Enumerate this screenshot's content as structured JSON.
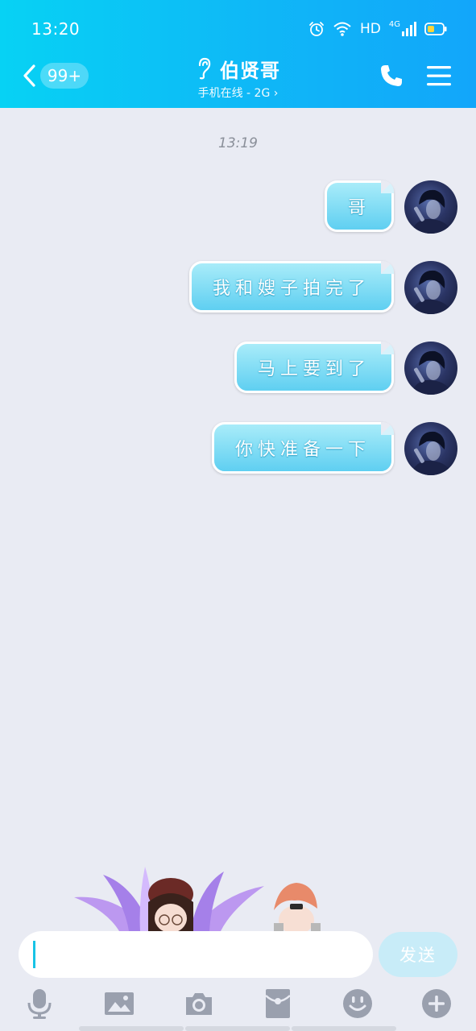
{
  "status_bar": {
    "time": "13:20",
    "network_label": "HD",
    "cellular_label": "4G"
  },
  "header": {
    "unread_count": "99+",
    "contact_name": "伯贤哥",
    "contact_status": "手机在线 - 2G ›"
  },
  "chat": {
    "timestamp": "13:19",
    "messages": [
      {
        "text": "哥",
        "direction": "outgoing"
      },
      {
        "text": "我和嫂子拍完了",
        "direction": "outgoing"
      },
      {
        "text": "马上要到了",
        "direction": "outgoing"
      },
      {
        "text": "你快准备一下",
        "direction": "outgoing"
      }
    ]
  },
  "input": {
    "value": "",
    "placeholder": "",
    "send_label": "发送"
  },
  "toolbar": {
    "items": [
      "mic-icon",
      "image-icon",
      "camera-icon",
      "red-packet-icon",
      "emoji-icon",
      "plus-icon"
    ]
  },
  "colors": {
    "header_gradient_start": "#07d2f4",
    "header_gradient_end": "#12a6fa",
    "chat_background": "#e9ebf3",
    "bubble_top": "#a9ecf9",
    "bubble_bottom": "#5fcff1",
    "send_button": "#c8ecf8",
    "toolbar_icon": "#9aa0ae"
  }
}
